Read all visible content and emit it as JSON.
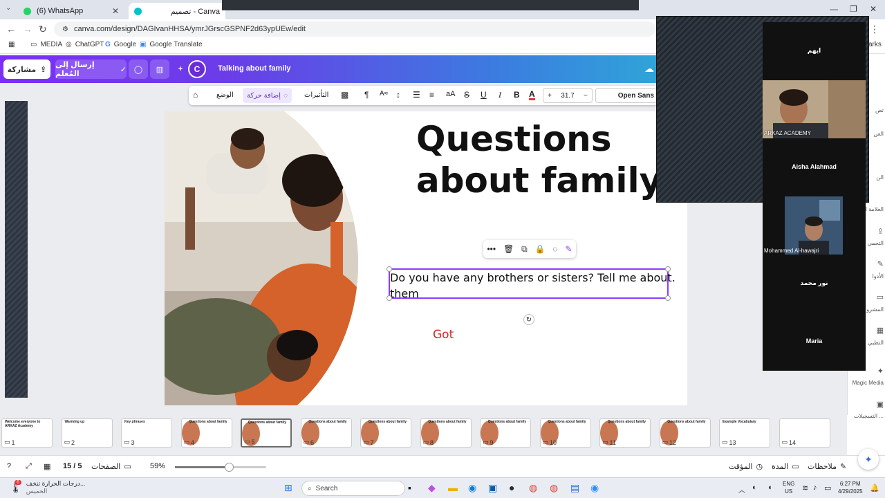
{
  "browser": {
    "tabs": [
      {
        "title": "(6) WhatsApp"
      },
      {
        "title": "تصميم - Canva"
      }
    ],
    "url": "canva.com/design/DAGIvanHHSA/ymrJGrscGSPNF2d63ypUEw/edit",
    "bookmarks": [
      "MEDIA",
      "ChatGPT",
      "Google",
      "Google Translate"
    ],
    "bookmarks_overflow": "arks"
  },
  "canva_header": {
    "share_label": "مشاركة",
    "send_label": "إرسال إلى المُعلم",
    "avatar_letter": "C",
    "doc_title": "Talking about family"
  },
  "toolbar": {
    "position_label": "الوضع",
    "animate_label": "إضافة حركة",
    "effects_label": "التأثيرات",
    "font_size": "31.7",
    "font_size_minus": "−",
    "font_size_plus": "+",
    "font_name": "Open Sans",
    "bold": "B",
    "italic": "I",
    "underline": "U",
    "strike": "S",
    "case": "aA"
  },
  "slide": {
    "title_line1": "Questions",
    "title_line2": "about family",
    "text_line1": "Do you have any brothers or sisters? Tell me about.",
    "text_line2": "them",
    "got": "Got"
  },
  "call": {
    "participants": [
      {
        "name": "ايهم"
      },
      {
        "name": "ARKAZ ACADEMY"
      },
      {
        "name": "Aisha Alahmad"
      },
      {
        "name": "Mohammed Al-hawajri"
      },
      {
        "name": "نور محمد"
      },
      {
        "name": "Maria"
      }
    ]
  },
  "right_rail": {
    "items": [
      "تص",
      "العن",
      "الن",
      "العلامة ال",
      "التحمي",
      "الأدوا",
      "المشرو",
      "التطبي"
    ],
    "magic_media": "Magic Media",
    "recordings": "التسجيلات ..."
  },
  "pages": {
    "thumbs": [
      {
        "num": "1",
        "title": "Welcome everyone to ARKAZ Academy"
      },
      {
        "num": "2",
        "title": "Warming up"
      },
      {
        "num": "3",
        "title": "Key phrases"
      },
      {
        "num": "4",
        "title": "Questions about family"
      },
      {
        "num": "5",
        "title": "Questions about family"
      },
      {
        "num": "6",
        "title": "Questions about family"
      },
      {
        "num": "7",
        "title": "Questions about family"
      },
      {
        "num": "8",
        "title": "Questions about family"
      },
      {
        "num": "9",
        "title": "Questions about family"
      },
      {
        "num": "10",
        "title": "Questions about family"
      },
      {
        "num": "11",
        "title": "Questions about family"
      },
      {
        "num": "12",
        "title": "Questions about family"
      },
      {
        "num": "13",
        "title": "Example Vocabulary"
      },
      {
        "num": "14",
        "title": ""
      }
    ],
    "selected": 5
  },
  "bottom": {
    "pages_label": "الصفحات",
    "page_counter": "15 / 5",
    "zoom": "59%",
    "zoom_fraction": 0.59,
    "timer_label": "المؤقت",
    "duration_label": "المدة",
    "notes_label": "ملاحظات"
  },
  "taskbar": {
    "weather_line1": "درجات الحرارة تنخف...",
    "weather_line2": "الخميس",
    "weather_badge": "6",
    "search_placeholder": "Search",
    "lang_line1": "ENG",
    "lang_line2": "US",
    "time": "6:27 PM",
    "date": "4/29/2025"
  },
  "colors": {
    "accent": "#8b3dff",
    "got_text": "#e02020",
    "header_start": "#7b2ff7",
    "header_end": "#2fa4d8"
  }
}
